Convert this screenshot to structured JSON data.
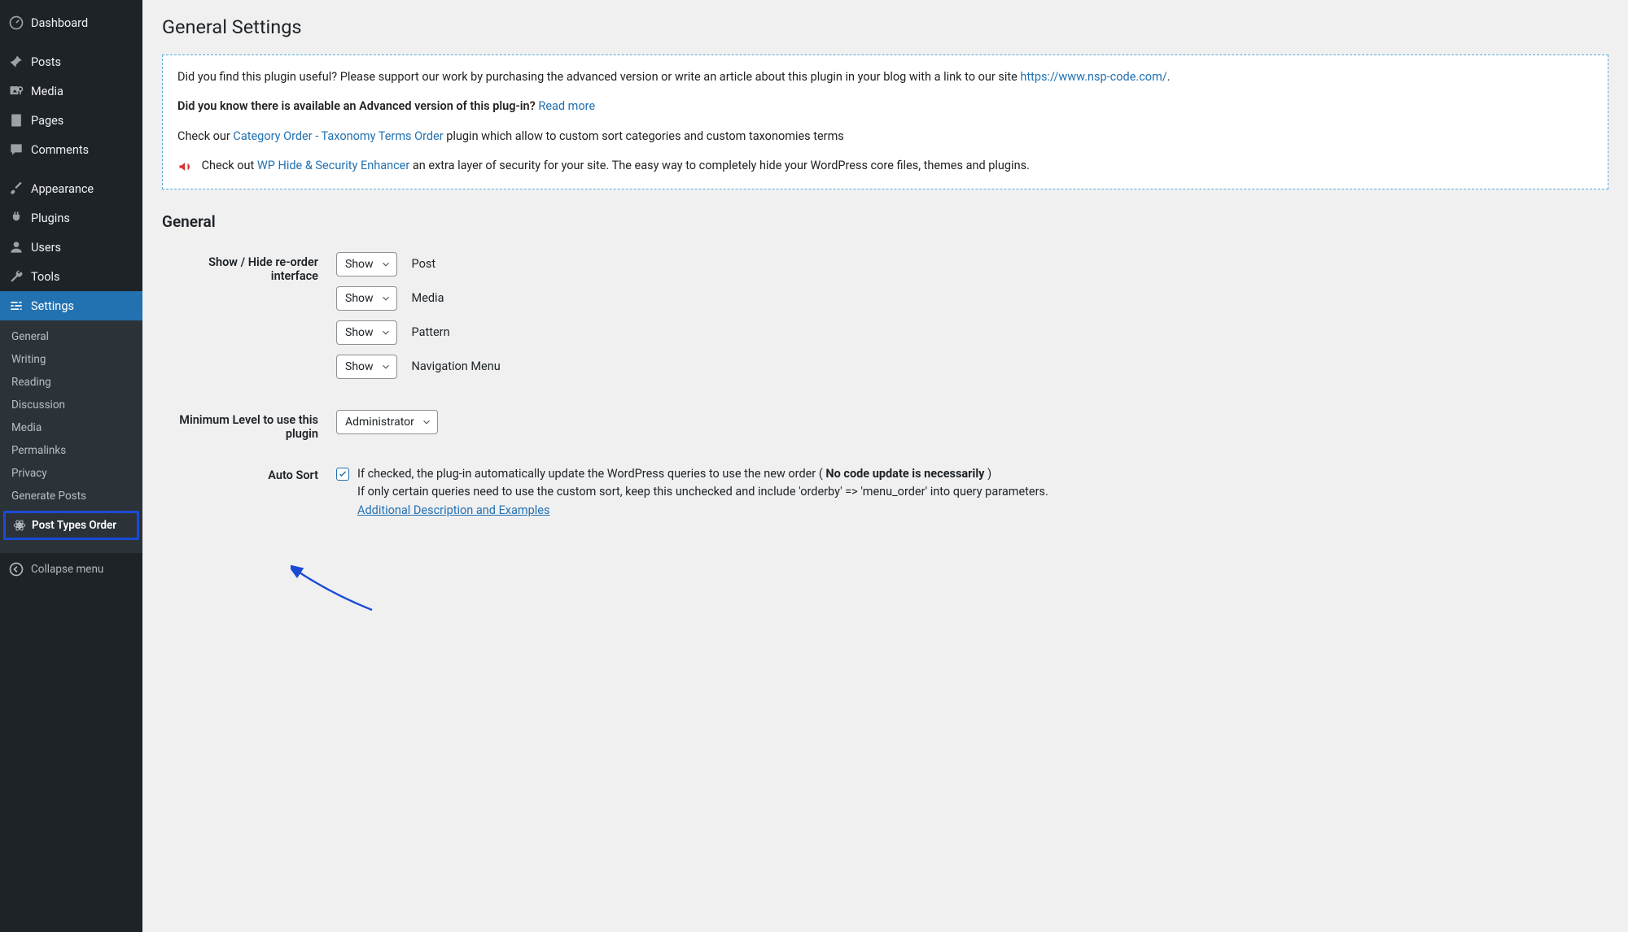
{
  "sidebar": {
    "menu": [
      {
        "label": "Dashboard",
        "icon": "dashboard"
      },
      {
        "label": "Posts",
        "icon": "pin"
      },
      {
        "label": "Media",
        "icon": "media"
      },
      {
        "label": "Pages",
        "icon": "page"
      },
      {
        "label": "Comments",
        "icon": "comment"
      },
      {
        "label": "Appearance",
        "icon": "brush"
      },
      {
        "label": "Plugins",
        "icon": "plug"
      },
      {
        "label": "Users",
        "icon": "user"
      },
      {
        "label": "Tools",
        "icon": "wrench"
      },
      {
        "label": "Settings",
        "icon": "sliders"
      }
    ],
    "submenu": [
      "General",
      "Writing",
      "Reading",
      "Discussion",
      "Media",
      "Permalinks",
      "Privacy",
      "Generate Posts"
    ],
    "highlighted_item": "Post Types Order",
    "collapse": "Collapse menu"
  },
  "page_title": "General Settings",
  "notice": {
    "line1_pre": "Did you find this plugin useful? Please support our work by purchasing the advanced version or write an article about this plugin in your blog with a link to our site ",
    "line1_link": "https://www.nsp-code.com/",
    "line2_strong": "Did you know there is available an Advanced version of this plug-in?",
    "line2_link": "Read more",
    "line3_pre": "Check our ",
    "line3_link": "Category Order - Taxonomy Terms Order",
    "line3_post": " plugin which allow to custom sort categories and custom taxonomies terms",
    "line4_pre": "Check out ",
    "line4_link": "WP Hide & Security Enhancer",
    "line4_post": " an extra layer of security for your site. The easy way to completely hide your WordPress core files, themes and plugins."
  },
  "section_heading": "General",
  "form": {
    "show_hide": {
      "label": "Show / Hide re-order interface",
      "rows": [
        {
          "select": "Show",
          "text": "Post"
        },
        {
          "select": "Show",
          "text": "Media"
        },
        {
          "select": "Show",
          "text": "Pattern"
        },
        {
          "select": "Show",
          "text": "Navigation Menu"
        }
      ]
    },
    "min_level": {
      "label": "Minimum Level to use this plugin",
      "select": "Administrator"
    },
    "auto_sort": {
      "label": "Auto Sort",
      "checked": true,
      "desc1_pre": "If checked, the plug-in automatically update the WordPress queries to use the new order ( ",
      "desc1_bold": "No code update is necessarily",
      "desc1_post": " )",
      "desc2": "If only certain queries need to use the custom sort, keep this unchecked and include 'orderby' => 'menu_order' into query parameters.",
      "desc_link": "Additional Description and Examples"
    }
  }
}
